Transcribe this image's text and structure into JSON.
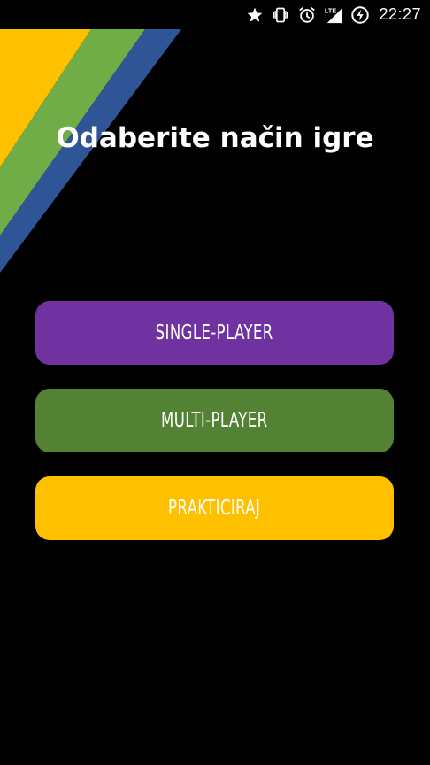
{
  "status_bar": {
    "time": "22:27",
    "network_label": "LTE",
    "icons": [
      "star-icon",
      "vibrate-icon",
      "alarm-icon",
      "lte-signal-icon",
      "battery-charging-icon"
    ]
  },
  "header": {
    "title": "Odaberite način igre"
  },
  "menu": {
    "single_player_label": "SINGLE-PLAYER",
    "multi_player_label": "MULTI-PLAYER",
    "practice_label": "PRAKTICIRAJ"
  },
  "colors": {
    "background": "#000000",
    "single_player": "#7032a0",
    "multi_player": "#548235",
    "practice": "#ffc000",
    "stripe_yellow": "#ffc000",
    "stripe_green": "#70ad47",
    "stripe_blue": "#2f5597"
  }
}
